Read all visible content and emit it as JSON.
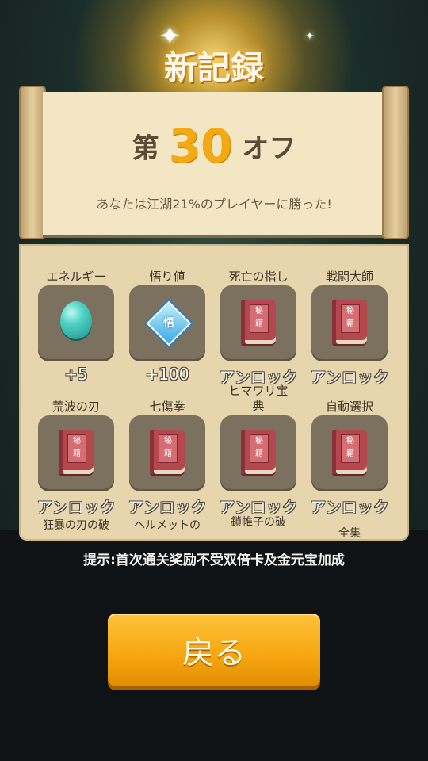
{
  "title": "新記録",
  "rank": {
    "prefix": "第",
    "number": "30",
    "suffix": "オフ"
  },
  "beat_message": "あなたは江湖21%のプレイヤーに勝った!",
  "rewards": [
    {
      "name": "エネルギー",
      "value": "+5",
      "icon": "energy-gem-icon"
    },
    {
      "name": "悟り値",
      "value": "+100",
      "icon": "enlightenment-badge-icon",
      "badge_text": "悟"
    },
    {
      "name": "死亡の指し",
      "value": "アンロック",
      "icon": "secret-book-icon"
    },
    {
      "name": "戦闘大師",
      "value": "アンロック",
      "icon": "secret-book-icon"
    },
    {
      "name": "荒波の刃",
      "value": "アンロック",
      "icon": "secret-book-icon"
    },
    {
      "name": "七傷拳",
      "value": "アンロック",
      "icon": "secret-book-icon"
    },
    {
      "name": "ヒマワリ宝典",
      "value": "アンロック",
      "icon": "secret-book-icon"
    },
    {
      "name": "自動選択",
      "value": "アンロック",
      "icon": "secret-book-icon"
    }
  ],
  "book_label": [
    "秘",
    "籍"
  ],
  "partial_rewards": [
    "狂暴の刃の破",
    "ヘルメットの",
    "鎖帷子の破",
    "全集"
  ],
  "hint": "提示:首次通关奖励不受双倍卡及金元宝加成",
  "back_button_label": "戻る",
  "colors": {
    "accent": "#f2a914",
    "button": "#f5a510",
    "panel": "#e6d5ad"
  }
}
